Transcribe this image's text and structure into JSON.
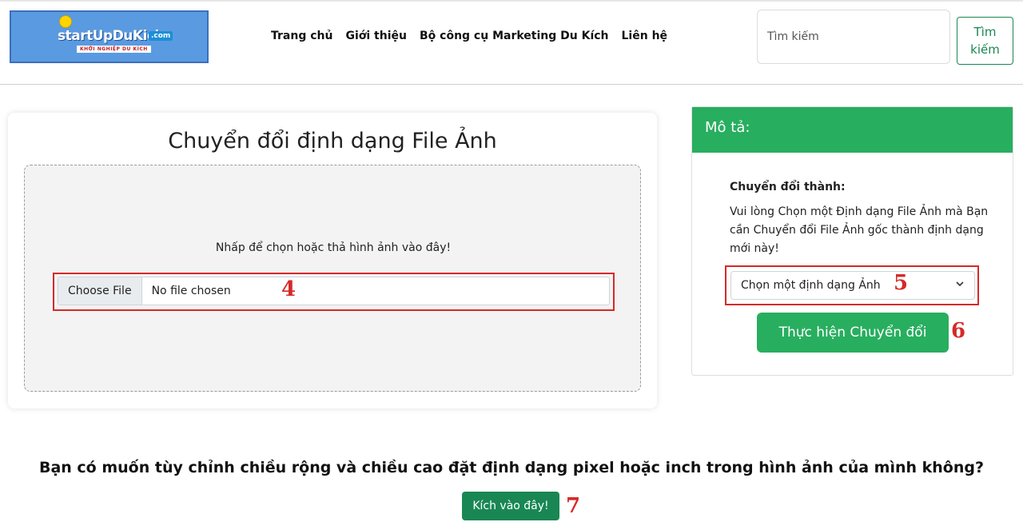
{
  "header": {
    "logo": {
      "main": "startUpDuKich",
      "com": ".com",
      "sub": "KHỞI NGHIỆP DU KÍCH"
    },
    "nav": [
      "Trang chủ",
      "Giới thiệu",
      "Bộ công cụ Marketing Du Kích",
      "Liên hệ"
    ],
    "search": {
      "placeholder": "Tìm kiếm",
      "button": "Tìm kiếm"
    }
  },
  "converter": {
    "title": "Chuyển đổi định dạng File Ảnh",
    "drop_text": "Nhấp để chọn hoặc thả hình ảnh vào đây!",
    "choose_file": "Choose File",
    "no_file": "No file chosen"
  },
  "sidebar": {
    "header": "Mô tả:",
    "convert_label": "Chuyển đổi thành:",
    "convert_desc": "Vui lòng Chọn một Định dạng File Ảnh mà Bạn cần Chuyển đổi File Ảnh gốc thành định dạng mới này!",
    "select_value": "Chọn một định dạng Ảnh",
    "convert_button": "Thực hiện Chuyển đổi"
  },
  "bottom": {
    "question": "Bạn có muốn tùy chỉnh chiều rộng và chiều cao đặt định dạng pixel hoặc inch trong hình ảnh của mình không?",
    "button": "Kích vào đây!"
  },
  "annotations": [
    "4",
    "5",
    "6",
    "7"
  ],
  "colors": {
    "brand_green": "#28ae5f",
    "dark_green": "#198754",
    "highlight_red": "#d62929"
  }
}
